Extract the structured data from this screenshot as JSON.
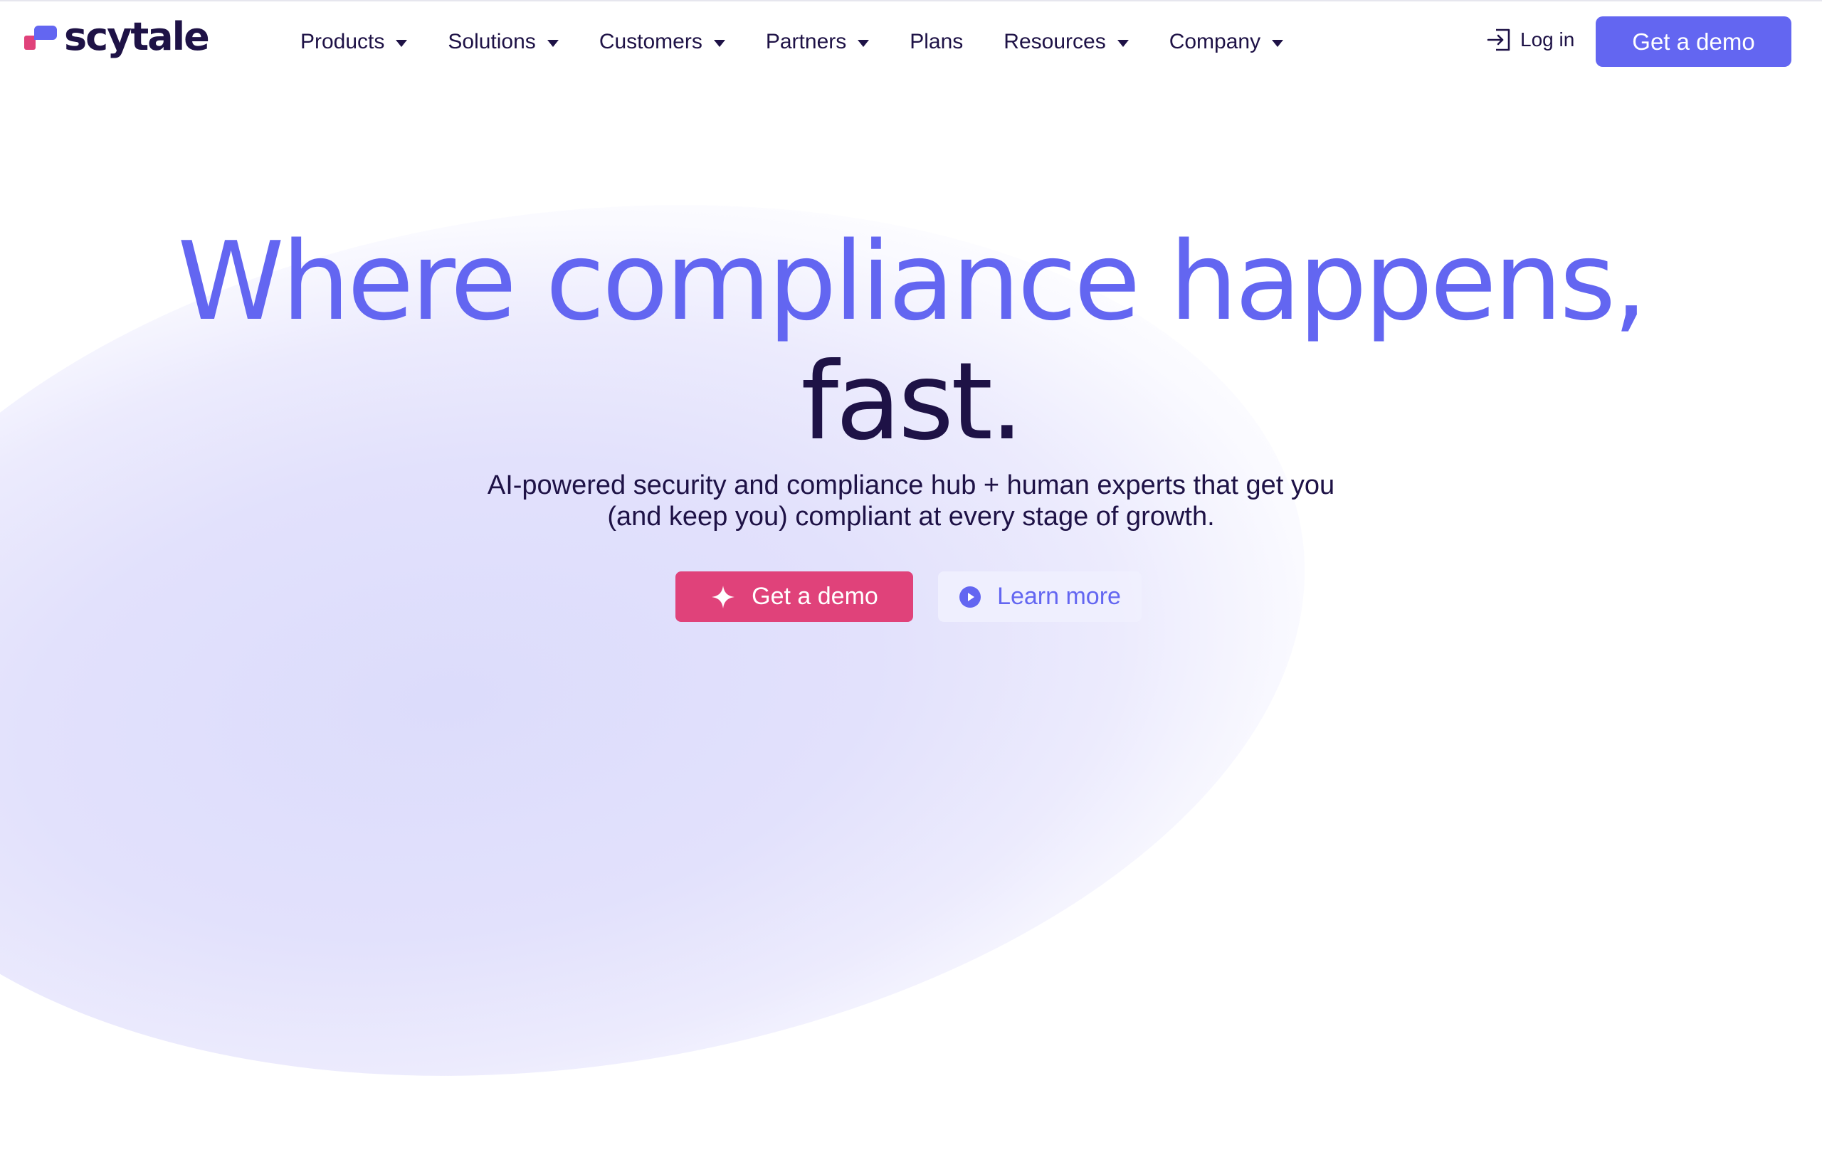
{
  "brand": {
    "name": "scytale"
  },
  "nav": {
    "items": [
      {
        "label": "Products",
        "has_dropdown": true
      },
      {
        "label": "Solutions",
        "has_dropdown": true
      },
      {
        "label": "Customers",
        "has_dropdown": true
      },
      {
        "label": "Partners",
        "has_dropdown": true
      },
      {
        "label": "Plans",
        "has_dropdown": false
      },
      {
        "label": "Resources",
        "has_dropdown": true
      },
      {
        "label": "Company",
        "has_dropdown": true
      }
    ],
    "login_label": "Log in",
    "demo_label": "Get a demo"
  },
  "hero": {
    "headline_line1": "Where compliance happens,",
    "headline_line2": "fast.",
    "subtitle_line1": "AI-powered security and compliance hub + human experts that get you",
    "subtitle_line2": "(and keep you) compliant at every stage of growth.",
    "primary_cta": "Get a demo",
    "secondary_cta": "Learn more"
  },
  "colors": {
    "accent": "#6366f1",
    "pink": "#e0427a",
    "text": "#1e1246",
    "background": "#ffffff"
  }
}
